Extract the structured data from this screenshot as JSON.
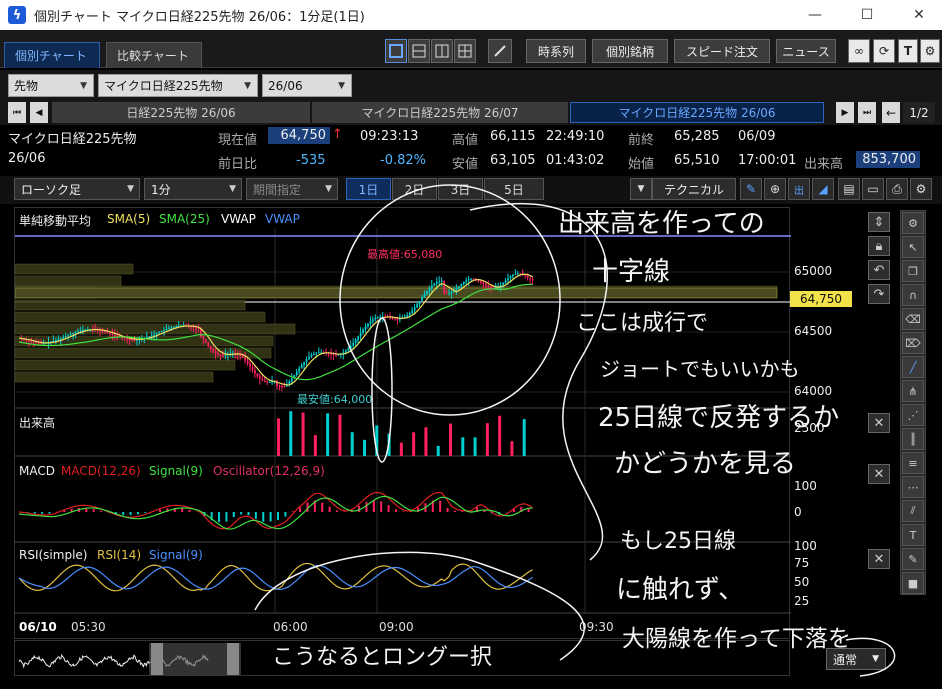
{
  "window": {
    "title": "個別チャート マイクロ日経225先物 26/06：1分足(1日)",
    "minimize_glyph": "—",
    "maximize_glyph": "☐",
    "close_glyph": "✕"
  },
  "tabs": [
    {
      "label": "個別チャート",
      "active": true
    },
    {
      "label": "比較チャート",
      "active": false
    }
  ],
  "toolbar": {
    "buttons": [
      "時系列",
      "個別銘柄",
      "スピード注文",
      "ニュース"
    ],
    "icons": [
      "layout-single-icon",
      "layout-split-h-icon",
      "layout-split-v-icon",
      "layout-quad-icon",
      "expand-icon",
      "link-icon",
      "refresh-icon",
      "text-icon",
      "settings-icon"
    ]
  },
  "selectors": {
    "market": "先物",
    "instrument": "マイクロ日経225先物",
    "contract": "26/06"
  },
  "instrument_tabs": [
    {
      "label": "日経225先物 26/06",
      "active": false
    },
    {
      "label": "マイクロ日経225先物 26/07",
      "active": false
    },
    {
      "label": "マイクロ日経225先物 26/06",
      "active": true
    }
  ],
  "page_indicator": "1/2",
  "quote": {
    "name": "マイクロ日経225先物",
    "contract": "26/06",
    "current_label": "現在値",
    "current": "64,750",
    "up_arrow": "↑",
    "current_time": "09:23:13",
    "change_label": "前日比",
    "change": "-535",
    "change_pct": "-0.82%",
    "high_label": "高値",
    "high": "66,115",
    "high_time": "22:49:10",
    "low_label": "安値",
    "low": "63,105",
    "low_time": "01:43:02",
    "prev_label": "前終",
    "prev": "65,285",
    "prev_date": "06/09",
    "open_label": "始値",
    "open": "65,510",
    "open_time": "17:00:01",
    "volume_label": "出来高",
    "volume": "853,700"
  },
  "chart_toolbar": {
    "chart_type": "ローソク足",
    "interval": "1分",
    "period": "期間指定",
    "ranges": [
      "1日",
      "2日",
      "3日",
      "5日"
    ],
    "active_range": "1日",
    "technical": "テクニカル"
  },
  "main_panel": {
    "title": "単純移動平均",
    "legend": [
      {
        "label": "SMA(5)",
        "color": "#f0e060"
      },
      {
        "label": "SMA(25)",
        "color": "#40e040"
      },
      {
        "label": "VWAP",
        "color": "#ffffff"
      },
      {
        "label": "VWAP",
        "color": "#4a90ff"
      }
    ],
    "high_marker": "最高値:65,080",
    "low_marker": "最安値:64,000",
    "y_ticks": [
      "65000",
      "64500",
      "64000"
    ],
    "price_tag": "64,750"
  },
  "volume_panel": {
    "title": "出来高",
    "y_ticks": [
      "2500"
    ]
  },
  "macd_panel": {
    "title": "MACD",
    "legend": [
      {
        "label": "MACD(12,26)",
        "color": "#e02020"
      },
      {
        "label": "Signal(9)",
        "color": "#40e040"
      },
      {
        "label": "Oscillator(12,26,9)",
        "color": "#e03060"
      }
    ],
    "y_ticks": [
      "100",
      "0"
    ]
  },
  "rsi_panel": {
    "title": "RSI(simple)",
    "legend": [
      {
        "label": "RSI(14)",
        "color": "#e0c040"
      },
      {
        "label": "Signal(9)",
        "color": "#4a90ff"
      }
    ],
    "y_ticks": [
      "100",
      "75",
      "50",
      "25"
    ]
  },
  "time_axis": [
    "06/10",
    "05:30",
    "06:00",
    "09:00",
    "09:30"
  ],
  "scroll_mode": "通常",
  "handwriting": [
    "出来高を作っての",
    "十字線",
    "ここは成行で",
    "ジョートでもいいかも",
    "25日線で反発するか",
    "かどうかを見る",
    "もし25日線",
    "に触れず、",
    "大陽線を作って下落を",
    "こうなるとロングー択"
  ],
  "colors": {
    "accent": "#2d63b8",
    "up": "#00d0d0",
    "down": "#ff2060",
    "volume_profile": "#4a4a20"
  }
}
